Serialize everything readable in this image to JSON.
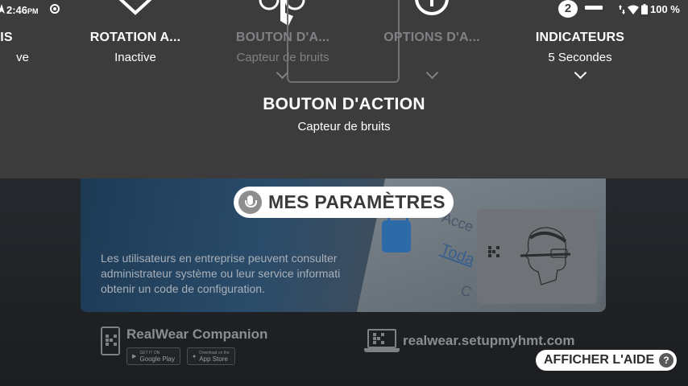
{
  "status_bar": {
    "time": "2:46",
    "ampm": "PM",
    "notification_count": "2",
    "battery": "100 %",
    "icons": [
      "location-icon",
      "record-icon",
      "minus-icon",
      "data-arrows-icon",
      "wifi-icon",
      "battery-icon"
    ]
  },
  "quick_settings": {
    "tiles": [
      {
        "label": "IS",
        "value": "ve",
        "icon": "partial-tile-icon"
      },
      {
        "label": "ROTATION A...",
        "value": "Inactive",
        "icon": "rotation-icon"
      },
      {
        "label": "BOUTON D'A...",
        "value": "Capteur de bruits",
        "icon": "touch-action-icon",
        "selected": true
      },
      {
        "label": "OPTIONS D'A...",
        "value": "",
        "icon": "power-icon"
      },
      {
        "label": "INDICATEURS",
        "value": "5 Secondes",
        "icon": "indicator-icon"
      }
    ],
    "detail": {
      "title": "BOUTON D'ACTION",
      "subtitle": "Capteur de bruits"
    }
  },
  "voice_prompt": {
    "label": "MES PARAMÈTRES",
    "icon": "microphone-icon"
  },
  "background": {
    "info_text": "Les utilisateurs en entreprise peuvent consulter administrateur système ou leur service informati obtenir un code de configuration.",
    "companion_title": "RealWear Companion",
    "store_google_top": "GET IT ON",
    "store_google": "Google Play",
    "store_apple_top": "Download on the",
    "store_apple": "App Store",
    "setup_url": "realwear.setupmyhmt.com",
    "photo_words": [
      "Acce",
      "Toda",
      "C"
    ]
  },
  "help_button": {
    "label": "AFFICHER L'AIDE",
    "icon": "question-icon"
  },
  "colors": {
    "panel": "#3c3c3c",
    "pill": "#ffffff",
    "dim_text": "#7f8185"
  }
}
